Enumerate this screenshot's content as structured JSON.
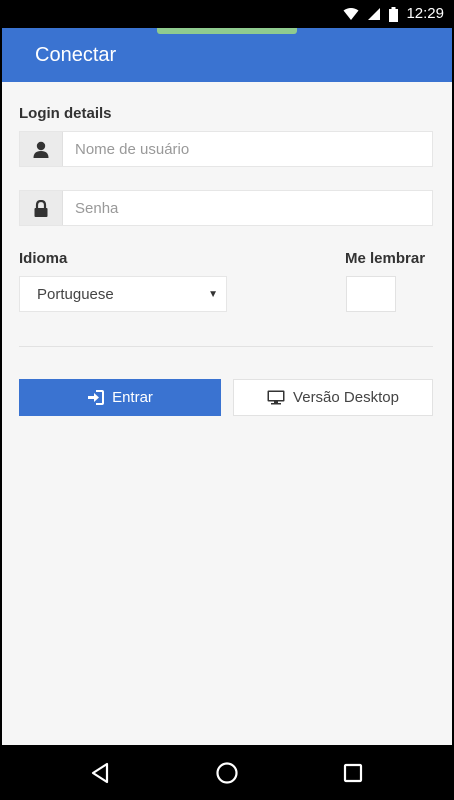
{
  "status_bar": {
    "time": "12:29",
    "icons": [
      "wifi-icon",
      "signal-icon",
      "battery-icon"
    ]
  },
  "header": {
    "title": "Conectar"
  },
  "login": {
    "section_label": "Login details",
    "username": {
      "placeholder": "Nome de usuário",
      "value": "",
      "icon": "user-icon"
    },
    "password": {
      "placeholder": "Senha",
      "value": "",
      "icon": "lock-icon"
    }
  },
  "language": {
    "label": "Idioma",
    "selected": "Portuguese"
  },
  "remember": {
    "label": "Me lembrar",
    "checked": false
  },
  "buttons": {
    "login_label": "Entrar",
    "login_icon": "sign-in-icon",
    "desktop_label": "Versão Desktop",
    "desktop_icon": "desktop-icon"
  },
  "nav_bar": {
    "icons": [
      "back-icon",
      "home-icon",
      "recents-icon"
    ]
  },
  "colors": {
    "primary": "#3a73d1",
    "background": "#f6f6f6",
    "accent_notch": "#8fcb8f"
  }
}
